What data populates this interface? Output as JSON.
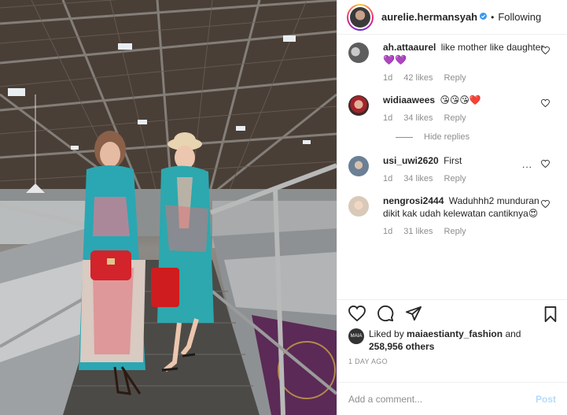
{
  "post": {
    "username": "aurelie.hermansyah",
    "verified_icon": "verified-badge-icon",
    "separator": "•",
    "follow_status": "Following"
  },
  "comments": [
    {
      "user": "ah.attaaurel",
      "text": "like mother like daughter 💜💜",
      "age": "1d",
      "likes": "42 likes",
      "reply": "Reply"
    },
    {
      "user": "widiaawees",
      "text": "😘😘😘❤️",
      "age": "1d",
      "likes": "34 likes",
      "reply": "Reply"
    },
    {
      "user": "usi_uwi2620",
      "text": "First",
      "age": "1d",
      "likes": "34 likes",
      "reply": "Reply"
    },
    {
      "user": "nengrosi2444",
      "text": "Waduhhh2 munduran dikit kak udah kelewatan cantiknya😍",
      "age": "1d",
      "likes": "31 likes",
      "reply": "Reply"
    }
  ],
  "hide_replies": "Hide replies",
  "more_options": "...",
  "likes": {
    "prefix": "Liked by",
    "by_user": "maiaestianty_fashion",
    "and": "and",
    "others": "258,956 others"
  },
  "time_ago": "1 DAY AGO",
  "add_comment": {
    "placeholder": "Add a comment...",
    "post_label": "Post"
  },
  "colors": {
    "link_blue": "#3897f0",
    "post_disabled": "#b3dbff",
    "meta_gray": "#8e8e8e"
  }
}
